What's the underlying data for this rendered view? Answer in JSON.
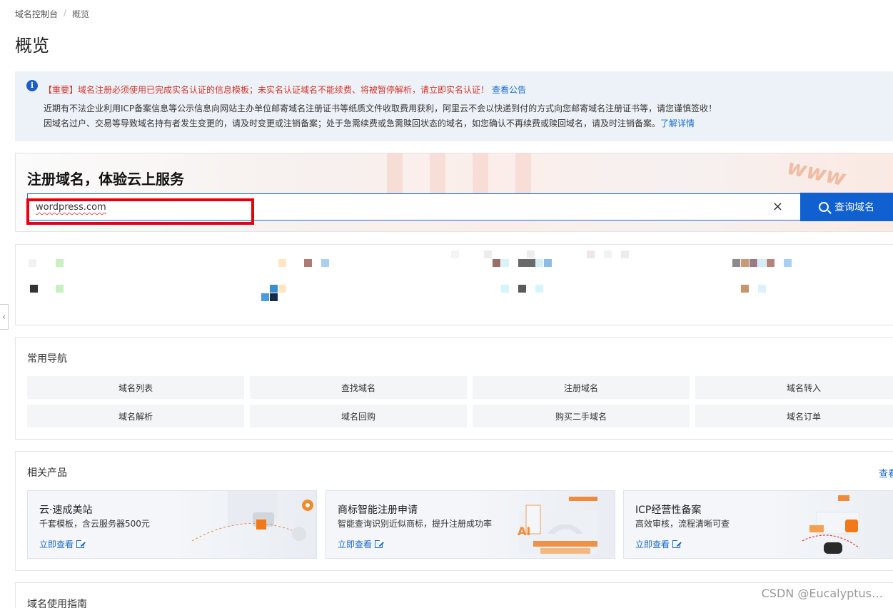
{
  "breadcrumb": {
    "root": "域名控制台",
    "separator": "/",
    "current": "概览"
  },
  "page_title": "概览",
  "notice": {
    "important": "【重要】域名注册必须使用已完成实名认证的信息模板；未实名认证域名不能续费、将被暂停解析，请立即实名认证！",
    "important_link": "查看公告",
    "line2": "近期有不法企业利用ICP备案信息等公示信息向网站主办单位邮寄域名注册证书等纸质文件收取费用获利，阿里云不会以快递到付的方式向您邮寄域名注册证书等，请您谨慎签收！",
    "line3": "因域名过户、交易等导致域名持有者发生变更的，请及时变更或注销备案；处于急需续费或急需赎回状态的域名，如您确认不再续费或赎回域名，请及时注销备案。",
    "line3_link": "了解详情"
  },
  "register": {
    "title": "注册域名，体验云上服务",
    "search_value": "wordpress.com",
    "clear_icon": "×",
    "button_label": "查询域名",
    "decor_text": "www"
  },
  "side_tab": "‹",
  "nav": {
    "title": "常用导航",
    "items": [
      "域名列表",
      "查找域名",
      "注册域名",
      "域名转入",
      "域名解析",
      "域名回购",
      "购买二手域名",
      "域名订单"
    ]
  },
  "products": {
    "title": "相关产品",
    "view_all": "查看",
    "items": [
      {
        "title": "云·速成美站",
        "desc": "千套模板，含云服务器500元",
        "link": "立即查看"
      },
      {
        "title": "商标智能注册申请",
        "desc": "智能查询识别近似商标，提升注册成功率",
        "link": "立即查看"
      },
      {
        "title": "ICP经营性备案",
        "desc": "高效审核，流程清晰可查",
        "link": "立即查看"
      }
    ]
  },
  "guide": {
    "title": "域名使用指南"
  },
  "watermark": "CSDN @Eucalyptus…"
}
